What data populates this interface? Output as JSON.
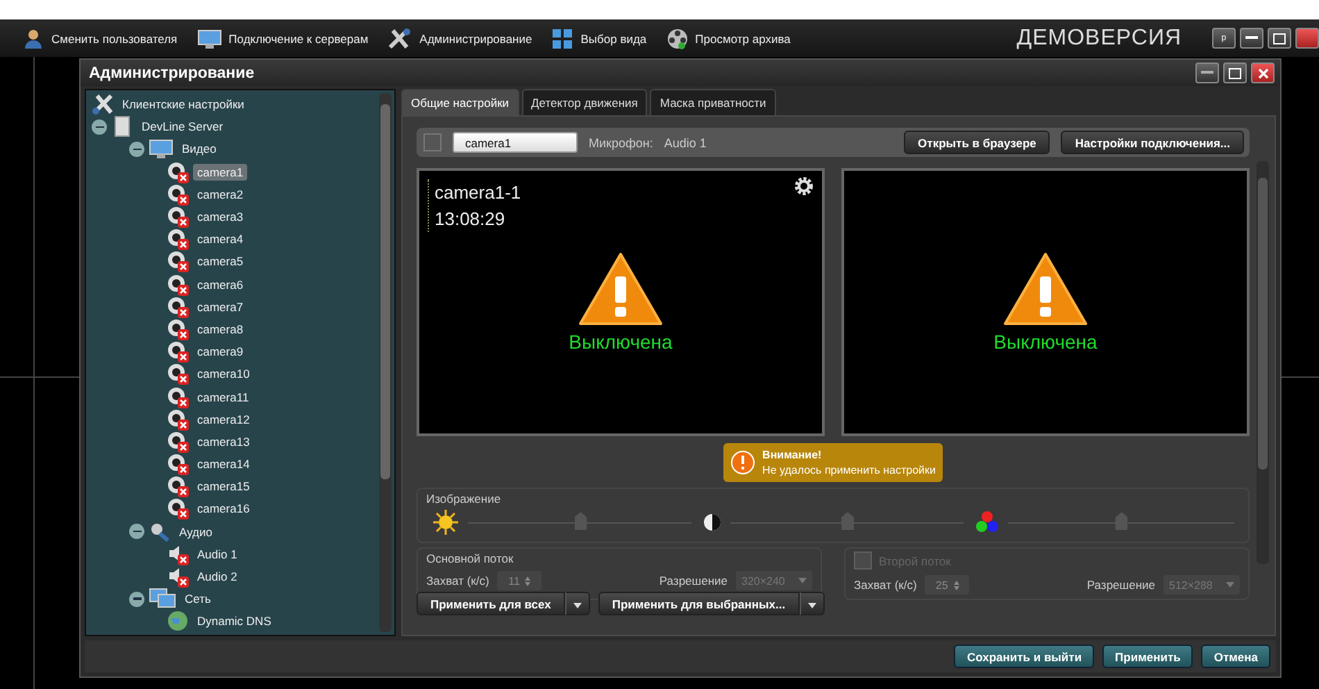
{
  "toolbar": {
    "items": [
      {
        "label": "Сменить пользователя",
        "kind": "user"
      },
      {
        "label": "Подключение к серверам",
        "kind": "servers"
      },
      {
        "label": "Администрирование",
        "kind": "admin"
      },
      {
        "label": "Выбор вида",
        "kind": "layout"
      },
      {
        "label": "Просмотр архива",
        "kind": "archive"
      }
    ],
    "demo_label": "ДЕМОВЕРСИЯ",
    "pin": "ᵖ"
  },
  "dialog": {
    "title": "Администрирование"
  },
  "tree": [
    {
      "label": "Клиентские настройки",
      "kind": "settings",
      "selected": false
    },
    {
      "label": "DevLine Server",
      "kind": "server",
      "expanded": true,
      "selected": false,
      "children": [
        {
          "label": "Видео",
          "kind": "video",
          "expanded": true,
          "selected": false,
          "children": [
            {
              "label": "camera1",
              "kind": "camera",
              "error": true,
              "selected": true
            },
            {
              "label": "camera2",
              "kind": "camera",
              "error": true,
              "selected": false
            },
            {
              "label": "camera3",
              "kind": "camera",
              "error": true,
              "selected": false
            },
            {
              "label": "camera4",
              "kind": "camera",
              "error": true,
              "selected": false
            },
            {
              "label": "camera5",
              "kind": "camera",
              "error": true,
              "selected": false
            },
            {
              "label": "camera6",
              "kind": "camera",
              "error": true,
              "selected": false
            },
            {
              "label": "camera7",
              "kind": "camera",
              "error": true,
              "selected": false
            },
            {
              "label": "camera8",
              "kind": "camera",
              "error": true,
              "selected": false
            },
            {
              "label": "camera9",
              "kind": "camera",
              "error": true,
              "selected": false
            },
            {
              "label": "camera10",
              "kind": "camera",
              "error": true,
              "selected": false
            },
            {
              "label": "camera11",
              "kind": "camera",
              "error": true,
              "selected": false
            },
            {
              "label": "camera12",
              "kind": "camera",
              "error": true,
              "selected": false
            },
            {
              "label": "camera13",
              "kind": "camera",
              "error": true,
              "selected": false
            },
            {
              "label": "camera14",
              "kind": "camera",
              "error": true,
              "selected": false
            },
            {
              "label": "camera15",
              "kind": "camera",
              "error": true,
              "selected": false
            },
            {
              "label": "camera16",
              "kind": "camera",
              "error": true,
              "selected": false
            }
          ]
        },
        {
          "label": "Аудио",
          "kind": "audio",
          "expanded": true,
          "selected": false,
          "children": [
            {
              "label": "Audio 1",
              "kind": "speaker",
              "error": true,
              "selected": false
            },
            {
              "label": "Audio 2",
              "kind": "speaker",
              "error": true,
              "selected": false
            }
          ]
        },
        {
          "label": "Сеть",
          "kind": "network",
          "expanded": true,
          "selected": false,
          "children": [
            {
              "label": "Dynamic DNS",
              "kind": "globe",
              "selected": false
            }
          ]
        }
      ]
    }
  ],
  "tabs": [
    {
      "label": "Общие настройки",
      "selected": true
    },
    {
      "label": "Детектор движения",
      "selected": false
    },
    {
      "label": "Маска приватности",
      "selected": false
    }
  ],
  "camera_bar": {
    "checked": false,
    "name": "camera1",
    "mic_label": "Микрофон:",
    "mic_value": "Audio 1",
    "buttons": [
      "Открыть в браузере",
      "Настройки подключения..."
    ]
  },
  "previews": [
    {
      "title": "camera1-1",
      "time": "13:08:29",
      "status": "Выключена",
      "settings_icon": true
    },
    {
      "status": "Выключена",
      "settings_icon": false
    }
  ],
  "warning": {
    "title": "Внимание!",
    "message": "Не удалось применить настройки"
  },
  "image": {
    "label": "Изображение",
    "sliders": [
      {
        "kind": "brightness",
        "level": 0.5
      },
      {
        "kind": "contrast",
        "level": 0.5
      },
      {
        "kind": "color",
        "level": 0.5
      }
    ]
  },
  "streams": [
    {
      "kind": "main",
      "title": "Основной поток",
      "disabled": true,
      "capture_label": "Захват (к/с)",
      "capture": "11",
      "resolution_label": "Разрешение",
      "resolution": "320×240"
    },
    {
      "kind": "optional",
      "title": "Второй поток",
      "checked": false,
      "disabled": true,
      "capture_label": "Захват (к/с)",
      "capture": "25",
      "resolution_label": "Разрешение",
      "resolution": "512×288"
    }
  ],
  "apply_buttons": [
    "Применить для всех",
    "Применить для выбранных..."
  ],
  "footer_buttons": [
    "Сохранить и выйти",
    "Применить",
    "Отмена"
  ]
}
